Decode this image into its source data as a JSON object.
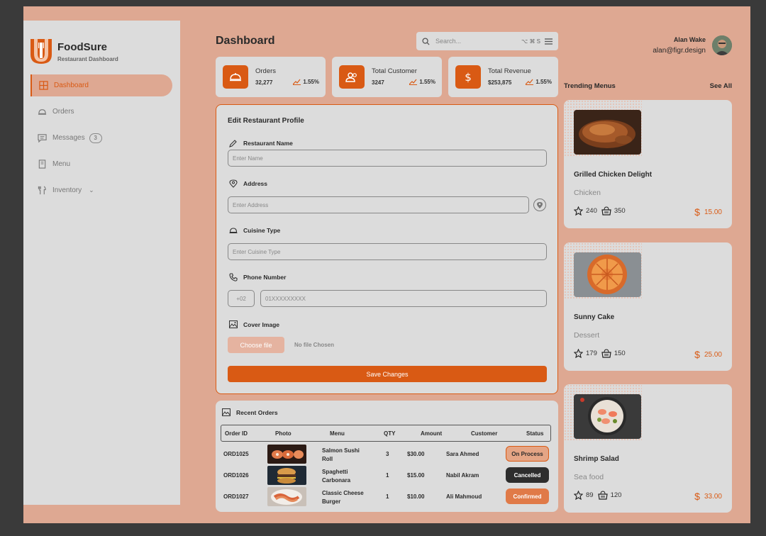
{
  "brand": {
    "name": "FoodSure",
    "subtitle": "Restaurant Dashboard"
  },
  "sidebar": {
    "items": [
      {
        "label": "Dashboard",
        "icon": "grid-icon",
        "active": true
      },
      {
        "label": "Orders",
        "icon": "cloche-icon"
      },
      {
        "label": "Messages",
        "icon": "chat-icon",
        "badge": "3"
      },
      {
        "label": "Menu",
        "icon": "book-icon"
      },
      {
        "label": "Inventory",
        "icon": "utensils-icon",
        "expandable": true
      }
    ]
  },
  "header": {
    "title": "Dashboard",
    "search_placeholder": "Search...",
    "shortcut": "⌥ ⌘ S",
    "user_name": "Alan Wake",
    "user_email": "alan@figr.design"
  },
  "stats": [
    {
      "label": "Orders",
      "value": "32,277",
      "change": "1.55%",
      "icon": "cloche-icon"
    },
    {
      "label": "Total Customer",
      "value": "3247",
      "change": "1.55%",
      "icon": "users-icon"
    },
    {
      "label": "Total Revenue",
      "value": "$253,875",
      "change": "1.55%",
      "icon": "dollar-icon"
    }
  ],
  "edit_profile": {
    "title": "Edit Restaurant Profile",
    "name_label": "Restaurant Name",
    "name_placeholder": "Enter Name",
    "address_label": "Address",
    "address_placeholder": "Enter Address",
    "cuisine_label": "Cuisine Type",
    "cuisine_placeholder": "Enter Cuisine Type",
    "phone_label": "Phone Number",
    "phone_code": "+02",
    "phone_placeholder": "01XXXXXXXXX",
    "cover_label": "Cover Image",
    "choose_file": "Choose file",
    "no_file": "No file Chosen",
    "save": "Save Changes"
  },
  "recent_orders": {
    "title": "Recent Orders",
    "columns": [
      "Order ID",
      "Photo",
      "Menu",
      "QTY",
      "Amount",
      "Customer",
      "Status"
    ],
    "rows": [
      {
        "id": "ORD1025",
        "menu": "Salmon Sushi Roll",
        "qty": "3",
        "amount": "$30.00",
        "customer": "Sara Ahmed",
        "status": "On Process"
      },
      {
        "id": "ORD1026",
        "menu": "Spaghetti Carbonara",
        "qty": "1",
        "amount": "$15.00",
        "customer": "Nabil Akram",
        "status": "Cancelled"
      },
      {
        "id": "ORD1027",
        "menu": "Classic Cheese Burger",
        "qty": "1",
        "amount": "$10.00",
        "customer": "Ali Mahmoud",
        "status": "Confirmed"
      }
    ]
  },
  "trending": {
    "title": "Trending Menus",
    "see_all": "See All",
    "items": [
      {
        "name": "Grilled Chicken Delight",
        "category": "Chicken",
        "rating": "240",
        "orders": "350",
        "price": "15.00"
      },
      {
        "name": "Sunny Cake",
        "category": "Dessert",
        "rating": "179",
        "orders": "150",
        "price": "25.00"
      },
      {
        "name": "Shrimp Salad",
        "category": "Sea food",
        "rating": "89",
        "orders": "120",
        "price": "33.00"
      }
    ]
  },
  "colors": {
    "accent": "#d95a14",
    "canvas": "#dea892",
    "panel": "#dcdcdc"
  }
}
